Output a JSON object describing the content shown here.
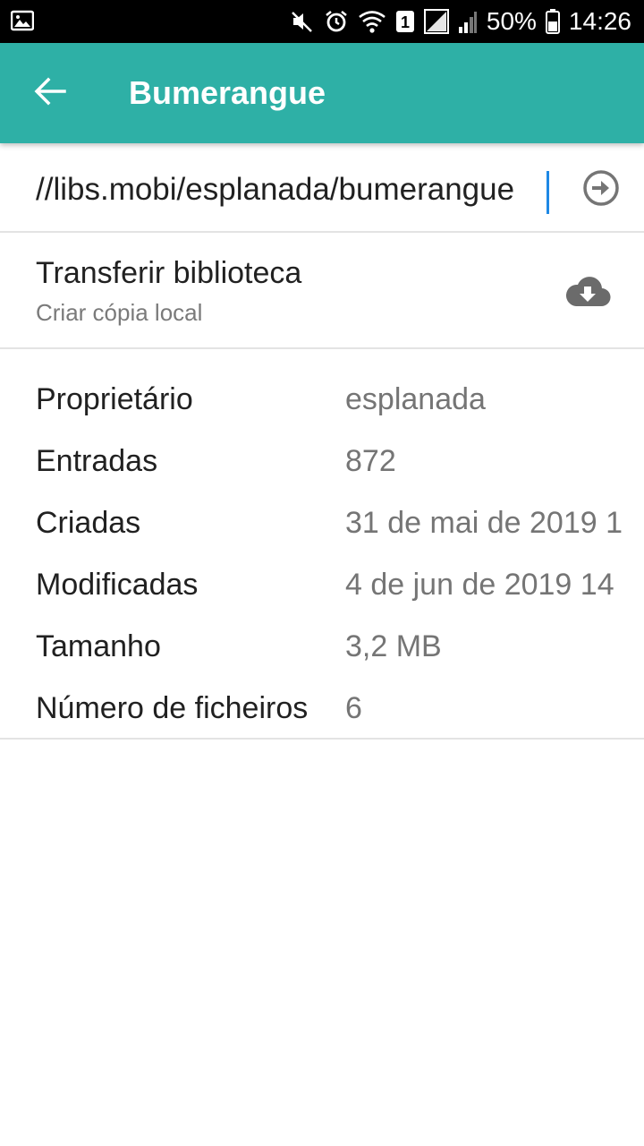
{
  "status_bar": {
    "battery": "50%",
    "time": "14:26",
    "sim_slot": "1"
  },
  "app_bar": {
    "title": "Bumerangue",
    "back_icon": "arrow-back-icon"
  },
  "url_field": {
    "value": "//libs.mobi/esplanada/bumerangue",
    "go_icon": "arrow-circle-right-icon"
  },
  "transfer": {
    "title": "Transferir biblioteca",
    "subtitle": "Criar cópia local",
    "icon": "cloud-download-icon"
  },
  "info": {
    "rows": [
      {
        "label": "Proprietário",
        "value": "esplanada"
      },
      {
        "label": "Entradas",
        "value": "872"
      },
      {
        "label": "Criadas",
        "value": "31 de mai de 2019 1"
      },
      {
        "label": "Modificadas",
        "value": "4 de jun de 2019 14"
      },
      {
        "label": "Tamanho",
        "value": "3,2 MB"
      },
      {
        "label": "Número de ficheiros",
        "value": "6"
      }
    ]
  },
  "colors": {
    "app_bar": "#2eb0a6",
    "caret": "#1e88e5",
    "secondary_text": "#757575"
  }
}
